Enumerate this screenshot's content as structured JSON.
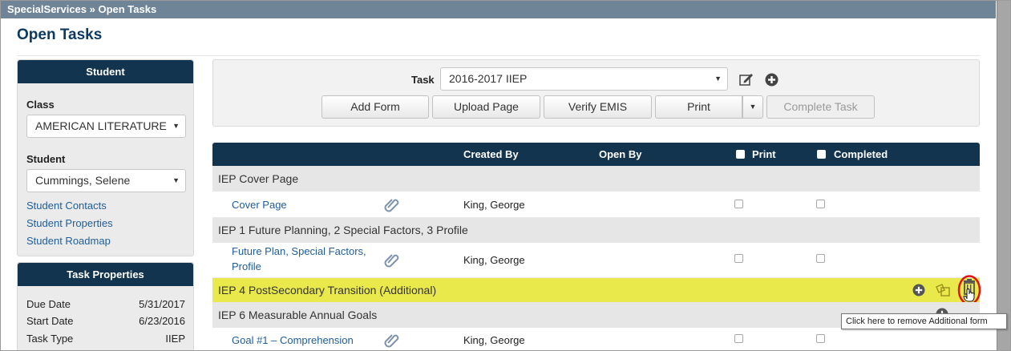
{
  "breadcrumb": {
    "text": "SpecialServices » Open Tasks"
  },
  "page": {
    "title": "Open Tasks"
  },
  "student_panel": {
    "title": "Student",
    "class_label": "Class",
    "class_value": "AMERICAN LITERATURE",
    "student_label": "Student",
    "student_value": "Cummings, Selene",
    "links": [
      "Student Contacts",
      "Student Properties",
      "Student Roadmap"
    ]
  },
  "task_properties": {
    "title": "Task Properties",
    "rows": [
      {
        "label": "Due Date",
        "value": "5/31/2017"
      },
      {
        "label": "Start Date",
        "value": "6/23/2016"
      },
      {
        "label": "Task Type",
        "value": "IIEP"
      }
    ]
  },
  "task_bar": {
    "task_label": "Task",
    "task_value": "2016-2017 IIEP",
    "buttons": {
      "add_form": "Add Form",
      "upload_page": "Upload Page",
      "verify_emis": "Verify EMIS",
      "print": "Print",
      "complete_task": "Complete Task"
    }
  },
  "grid": {
    "columns": {
      "created_by": "Created By",
      "open_by": "Open By",
      "print": "Print",
      "completed": "Completed"
    },
    "groups": [
      {
        "title": "IEP Cover Page",
        "items": [
          {
            "name": "Cover Page",
            "created_by": "King, George"
          }
        ]
      },
      {
        "title": "IEP 1 Future Planning, 2 Special Factors, 3 Profile",
        "items": [
          {
            "name": "Future Plan, Special Factors, Profile",
            "created_by": "King, George"
          }
        ]
      },
      {
        "title": "IEP 4 PostSecondary Transition (Additional)",
        "items": []
      },
      {
        "title": "IEP 6 Measurable Annual Goals",
        "items": [
          {
            "name": "Goal #1 – Comprehension",
            "created_by": "King, George"
          }
        ]
      }
    ]
  },
  "tooltip": {
    "text": "Click here to remove Additional form"
  },
  "icons": {
    "edit": "edit-icon",
    "add": "plus-circle-icon",
    "attachment": "paperclip-icon",
    "copy": "copy-icon",
    "delete": "trash-icon",
    "pointer": "hand-pointer-icon"
  },
  "colors": {
    "header_navy": "#12344f",
    "breadcrumb_bg": "#6f8597",
    "highlight_yellow": "#eae94b",
    "link_blue": "#1f5d99",
    "title_blue": "#0d3a62"
  }
}
